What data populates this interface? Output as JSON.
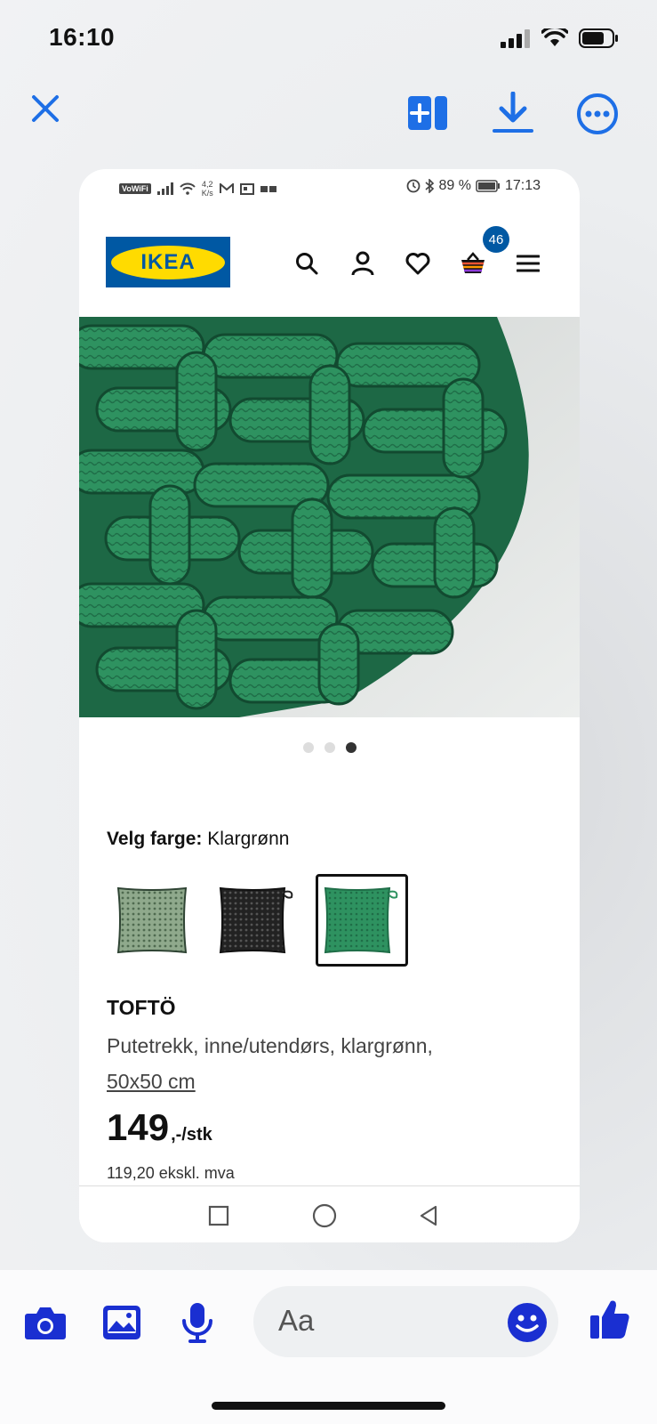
{
  "ios_status": {
    "time": "16:10"
  },
  "viewer": {
    "close": "close",
    "actions": [
      "add-to-page",
      "download",
      "more"
    ]
  },
  "android_status": {
    "volte": "VoWiFi",
    "speed_value": "4,2",
    "speed_unit": "K/s",
    "battery": "89 %",
    "time": "17:13"
  },
  "ikea": {
    "logo": "IKEA",
    "cart_count": "46"
  },
  "gallery": {
    "dot_count": 3,
    "active_dot": 3
  },
  "product": {
    "color_label": "Velg farge:",
    "color_value": "Klargrønn",
    "name": "TOFTÖ",
    "desc": "Putetrekk, inne/utendørs, klargrønn,",
    "size": "50x50 cm",
    "price": "149",
    "price_suffix": ",-/stk",
    "price_ex_vat": "119,20 ekskl. mva"
  },
  "colors": {
    "green": "#2e9260",
    "ikea_blue": "#0058a3",
    "ikea_yellow": "#ffdb00",
    "messenger_blue": "#1a2fd1"
  },
  "composer": {
    "placeholder": "Aa"
  }
}
